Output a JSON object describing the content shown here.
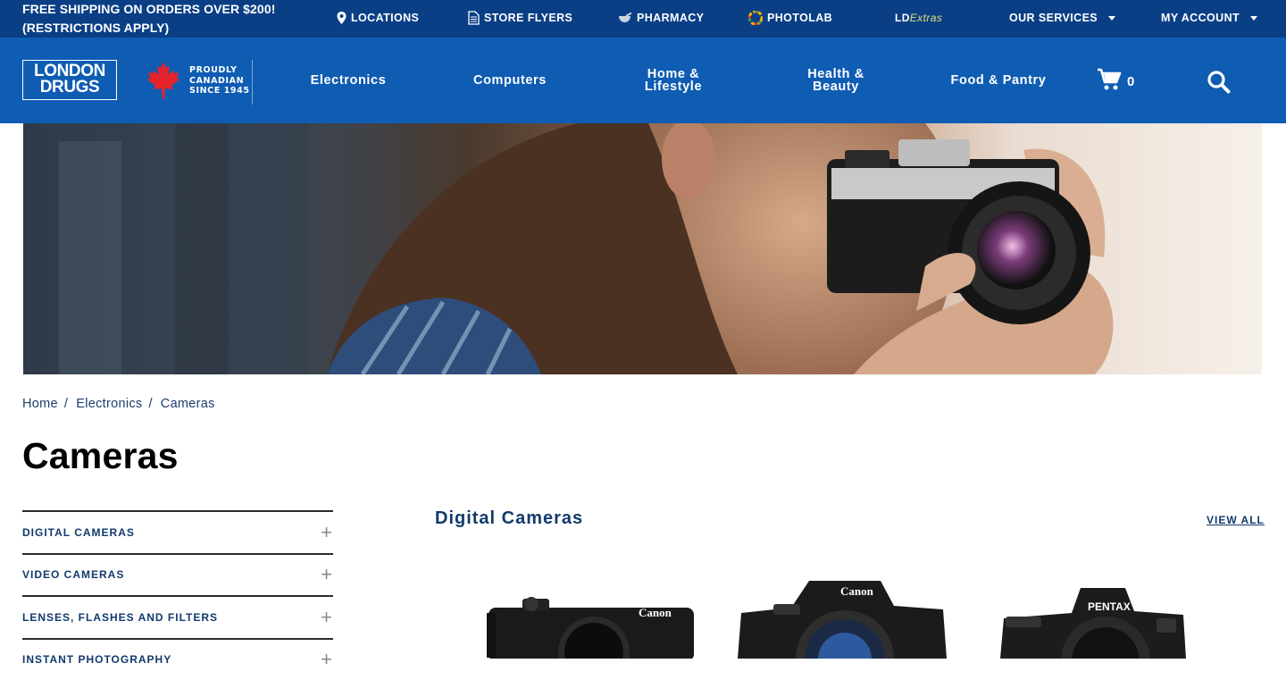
{
  "topbar": {
    "promo_line1": "FREE SHIPPING ON ORDERS OVER $200!",
    "promo_line2": "(RESTRICTIONS APPLY)",
    "locations": "LOCATIONS",
    "store_flyers": "STORE FLYERS",
    "pharmacy": "PHARMACY",
    "photolab": "PHOTOLAB",
    "ld_extras_prefix": "LD",
    "ld_extras_suffix": "Extras",
    "our_services": "OUR SERVICES",
    "my_account": "MY ACCOUNT"
  },
  "header": {
    "logo_line1": "LONDON",
    "logo_line2": "DRUGS",
    "tagline_line1": "PROUDLY",
    "tagline_line2": "CANADIAN",
    "tagline_line3": "SINCE 1945",
    "nav": [
      {
        "line1": "Electronics",
        "line2": ""
      },
      {
        "line1": "Computers",
        "line2": ""
      },
      {
        "line1": "Home &",
        "line2": "Lifestyle"
      },
      {
        "line1": "Health &",
        "line2": "Beauty"
      },
      {
        "line1": "Food & Pantry",
        "line2": ""
      }
    ],
    "cart_count": "0"
  },
  "breadcrumb": {
    "items": [
      "Home",
      "Electronics",
      "Cameras"
    ],
    "separator": "/"
  },
  "page_title": "Cameras",
  "sidebar": {
    "items": [
      {
        "label": "DIGITAL CAMERAS",
        "icon": "+"
      },
      {
        "label": "VIDEO CAMERAS",
        "icon": "+"
      },
      {
        "label": "LENSES, FLASHES AND FILTERS",
        "icon": "+"
      },
      {
        "label": "INSTANT PHOTOGRAPHY",
        "icon": "+"
      }
    ]
  },
  "section": {
    "title": "Digital Cameras",
    "view_all": "VIEW ALL",
    "products": [
      {
        "brand": "Canon"
      },
      {
        "brand": "Canon"
      },
      {
        "brand": "PENTAX"
      }
    ]
  },
  "colors": {
    "topbar": "#0a3f86",
    "header": "#0f5cb3",
    "link": "#123a6c"
  }
}
